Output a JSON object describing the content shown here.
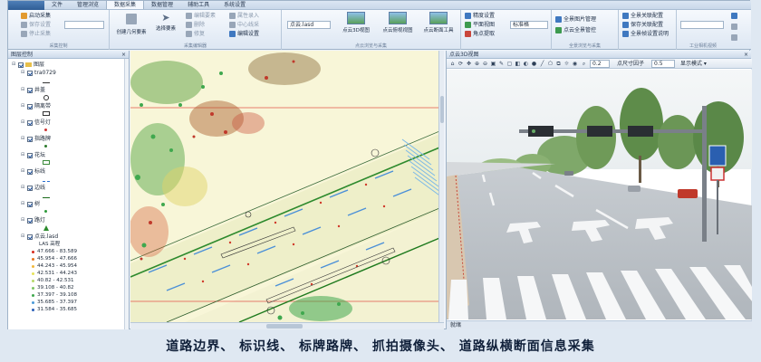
{
  "menu": {
    "tabs": [
      "文件",
      "管理浏览",
      "数据采集",
      "数据管理",
      "辅助工具",
      "系统设置"
    ],
    "active_tab": "数据采集"
  },
  "ribbon": {
    "group1": {
      "items": [
        "启动采集",
        "保存设置",
        "停止采集"
      ],
      "label": "采集控制"
    },
    "group2": {
      "items": [
        "创建几何要素",
        "选择要素",
        "编辑要素",
        "删除",
        "修复",
        "属性录入",
        "中心线采",
        "编辑设置"
      ],
      "label": "采集编辑器"
    },
    "group3": {
      "dropdown": "点云.lasd",
      "buttons": [
        "点云3D视图",
        "点云俯视视图",
        "点云断面工具"
      ],
      "label": "点云浏览与采集"
    },
    "group4": {
      "items": [
        "精度设置",
        "平面视图",
        "角点提取"
      ],
      "dropdown": "标准格",
      "label": ""
    },
    "group5": {
      "items": [
        "全景图片管理",
        "点云全景管控"
      ],
      "label": "全景浏览与采集"
    },
    "group6": {
      "items": [
        "全景关联配置",
        "保存关联配置",
        "全景帧设置说明"
      ],
      "label": ""
    },
    "group7": {
      "label": "工业相机视频"
    }
  },
  "tree": {
    "title": "图层控制",
    "close": "×",
    "root": "图层",
    "layers": [
      {
        "name": "tra0729"
      },
      {
        "name": "井盖"
      },
      {
        "name": "隔离带"
      },
      {
        "name": "信号灯"
      },
      {
        "name": "指路牌"
      },
      {
        "name": "花坛"
      },
      {
        "name": "标线"
      },
      {
        "name": "边线"
      },
      {
        "name": "树"
      },
      {
        "name": "路灯"
      },
      {
        "name": "点云.lasd"
      }
    ],
    "las_title": "LAS 高程",
    "las_ranges": [
      {
        "label": "47.666 - 83.589",
        "color": "#d62b1e"
      },
      {
        "label": "45.954 - 47.666",
        "color": "#e8761f"
      },
      {
        "label": "44.243 - 45.954",
        "color": "#f2b83a"
      },
      {
        "label": "42.531 - 44.243",
        "color": "#e6e35a"
      },
      {
        "label": "40.82 - 42.531",
        "color": "#b8d96a"
      },
      {
        "label": "39.108 - 40.82",
        "color": "#7cc464"
      },
      {
        "label": "37.397 - 39.108",
        "color": "#3fa84e"
      },
      {
        "label": "35.685 - 37.397",
        "color": "#4a9ad8"
      },
      {
        "label": "31.584 - 35.685",
        "color": "#2b5fb8"
      }
    ]
  },
  "view3d": {
    "title": "点云3D视图",
    "zoom_value": "0.2",
    "point_size_label": "点尺寸因子",
    "point_size_value": "0.5",
    "display_mode_label": "显示模式",
    "status": "就绪"
  },
  "caption": "道路边界、 标识线、 标牌路牌、 抓拍摄像头、 道路纵横断面信息采集",
  "colors": {
    "ribbon_bg": "#e7eef7",
    "map_bg": "#f8f6d8",
    "tree_bg": "#ffffff"
  }
}
